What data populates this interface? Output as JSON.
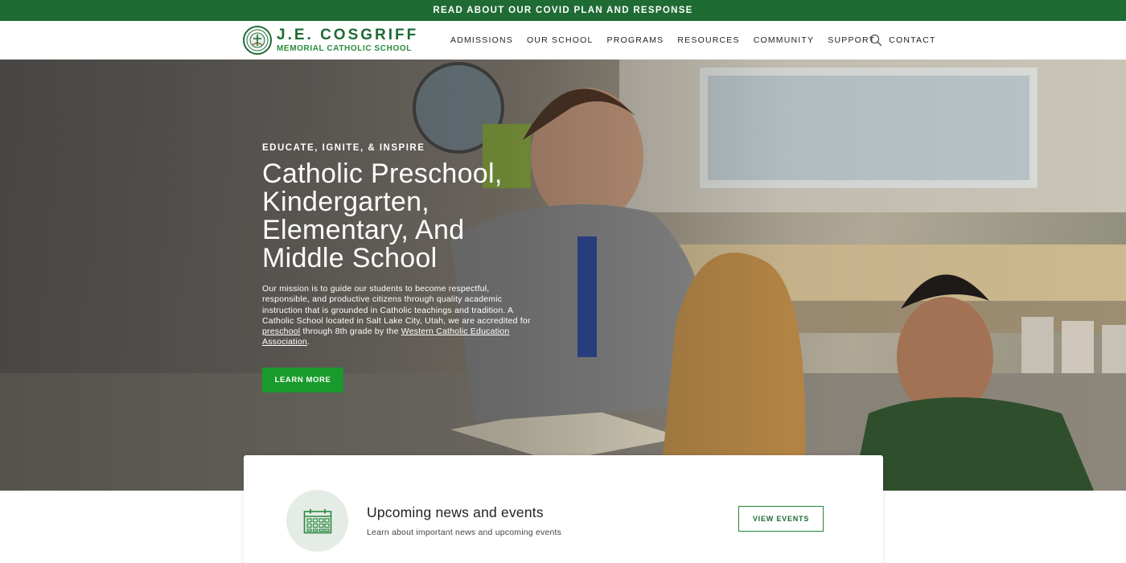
{
  "topbar": {
    "text": "READ ABOUT OUR COVID PLAN AND RESPONSE"
  },
  "logo": {
    "line1": "J.E. COSGRIFF",
    "line2": "MEMORIAL CATHOLIC SCHOOL"
  },
  "nav": {
    "items": [
      {
        "label": "ADMISSIONS"
      },
      {
        "label": "OUR SCHOOL"
      },
      {
        "label": "PROGRAMS"
      },
      {
        "label": "RESOURCES"
      },
      {
        "label": "COMMUNITY"
      },
      {
        "label": "SUPPORT"
      },
      {
        "label": "CONTACT"
      }
    ],
    "search_icon": "search-icon"
  },
  "hero": {
    "eyebrow": "EDUCATE, IGNITE, & INSPIRE",
    "title_lines": [
      "Catholic Preschool,",
      "Kindergarten,",
      "Elementary, And",
      "Middle School"
    ],
    "mission": {
      "part1": "Our mission is to guide our students to become respectful, responsible, and productive citizens through quality academic instruction that is grounded in Catholic teachings and tradition. A Catholic School located in Salt Lake City, Utah, we are accredited for ",
      "link1": "preschool",
      "part2": " through 8th grade by the ",
      "link2": "Western Catholic Education Association",
      "part3": "."
    },
    "button": "LEARN MORE"
  },
  "news": {
    "icon": "calendar-icon",
    "title": "Upcoming news and events",
    "subtitle": "Learn about important news and upcoming events",
    "button": "VIEW EVENTS"
  },
  "colors": {
    "brand_green": "#1e6b34",
    "button_green": "#1a9a2c",
    "icon_circle": "#e5ece6"
  }
}
